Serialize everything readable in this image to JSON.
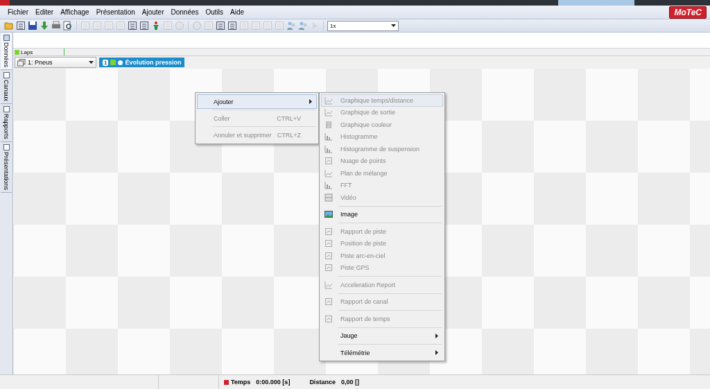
{
  "menu_bar": {
    "items": [
      "Fichier",
      "Editer",
      "Affichage",
      "Présentation",
      "Ajouter",
      "Données",
      "Outils",
      "Aide"
    ],
    "logo": "MoTeC"
  },
  "toolbar": {
    "groups": [
      [
        {
          "disabled": false
        },
        {
          "disabled": false
        },
        {
          "disabled": false
        },
        {
          "disabled": false
        },
        {
          "disabled": false
        },
        {
          "disabled": false
        }
      ],
      [
        {
          "disabled": true
        },
        {
          "disabled": true
        },
        {
          "disabled": true
        },
        {
          "disabled": true
        },
        {
          "disabled": false
        },
        {
          "disabled": false
        },
        {
          "disabled": false
        },
        {
          "disabled": true
        },
        {
          "disabled": true
        }
      ],
      [
        {
          "disabled": true
        },
        {
          "disabled": true
        },
        {
          "disabled": false
        },
        {
          "disabled": false
        },
        {
          "disabled": true
        },
        {
          "disabled": true
        },
        {
          "disabled": true
        },
        {
          "disabled": true
        },
        {
          "disabled": false
        },
        {
          "disabled": false
        },
        {
          "disabled": true
        }
      ]
    ],
    "zoom": {
      "value": "1x"
    }
  },
  "side_tabs": [
    {
      "label": "Données",
      "selected": true
    },
    {
      "label": "Canaux",
      "selected": false
    },
    {
      "label": "Rapports",
      "selected": false
    },
    {
      "label": "Présentations",
      "selected": false
    }
  ],
  "laps_bar": {
    "label": "Laps"
  },
  "worksheet": {
    "selector": "1: Pneus",
    "tabs": [
      {
        "number": "1",
        "label": "Évolution pression",
        "selected": true
      }
    ]
  },
  "context_menu": {
    "groups": [
      [
        {
          "label": "Ajouter",
          "submenu": true,
          "selected": true,
          "disabled": false
        }
      ],
      [
        {
          "label": "Coller",
          "shortcut": "CTRL+V",
          "submenu": false,
          "selected": false,
          "disabled": true
        }
      ],
      [
        {
          "label": "Annuler et supprimer",
          "shortcut": "CTRL+Z",
          "submenu": false,
          "selected": false,
          "disabled": true
        }
      ]
    ]
  },
  "submenu": {
    "groups": [
      [
        {
          "label": "Graphique temps/distance",
          "disabled": true,
          "selected": true,
          "submenu": false
        },
        {
          "label": "Graphique de sortie",
          "disabled": true,
          "selected": false,
          "submenu": false
        },
        {
          "label": "Graphique couleur",
          "disabled": true,
          "selected": false,
          "submenu": false
        },
        {
          "label": "Histogramme",
          "disabled": true,
          "selected": false,
          "submenu": false
        },
        {
          "label": "Histogramme de suspension",
          "disabled": true,
          "selected": false,
          "submenu": false
        },
        {
          "label": "Nuage de points",
          "disabled": true,
          "selected": false,
          "submenu": false
        },
        {
          "label": "Plan de mélange",
          "disabled": true,
          "selected": false,
          "submenu": false
        },
        {
          "label": "FFT",
          "disabled": true,
          "selected": false,
          "submenu": false
        },
        {
          "label": "Vidéo",
          "disabled": true,
          "selected": false,
          "submenu": false
        }
      ],
      [
        {
          "label": "Image",
          "disabled": false,
          "selected": false,
          "submenu": false
        }
      ],
      [
        {
          "label": "Rapport de piste",
          "disabled": true,
          "selected": false,
          "submenu": false
        },
        {
          "label": "Position de piste",
          "disabled": true,
          "selected": false,
          "submenu": false
        },
        {
          "label": "Piste arc-en-ciel",
          "disabled": true,
          "selected": false,
          "submenu": false
        },
        {
          "label": "Piste GPS",
          "disabled": true,
          "selected": false,
          "submenu": false
        }
      ],
      [
        {
          "label": "Acceleration Report",
          "disabled": true,
          "selected": false,
          "submenu": false
        }
      ],
      [
        {
          "label": "Rapport de canal",
          "disabled": true,
          "selected": false,
          "submenu": false
        }
      ],
      [
        {
          "label": "Rapport de temps",
          "disabled": true,
          "selected": false,
          "submenu": false
        }
      ],
      [
        {
          "label": "Jauge",
          "disabled": false,
          "selected": false,
          "submenu": true
        }
      ],
      [
        {
          "label": "Télémétrie",
          "disabled": false,
          "selected": false,
          "submenu": true
        }
      ]
    ]
  },
  "status_bar": {
    "time_label": "Temps",
    "time_value": "0:00.000 [s]",
    "distance_label": "Distance",
    "distance_value": "0,00 []"
  }
}
